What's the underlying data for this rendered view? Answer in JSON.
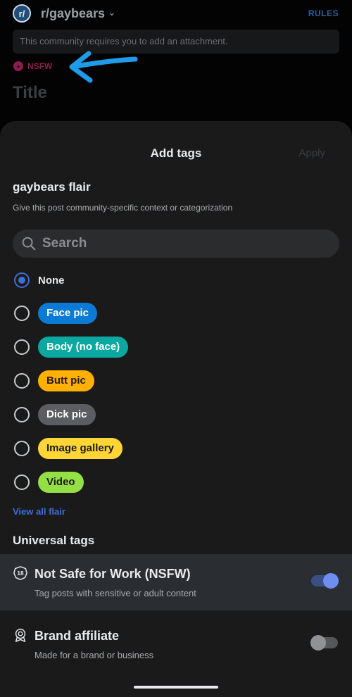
{
  "composer": {
    "subreddit": "r/gaybears",
    "avatar_letter": "r/",
    "rules_label": "RULES",
    "attachment_notice": "This community requires you to add an attachment.",
    "nsfw_label": "NSFW",
    "title_placeholder": "Title",
    "annotation_color": "#1e9be9"
  },
  "sheet": {
    "title": "Add tags",
    "apply_label": "Apply",
    "flair_heading": "gaybears flair",
    "flair_subtitle": "Give this post community-specific context or categorization",
    "search_placeholder": "Search",
    "options": [
      {
        "label": "None",
        "selected": true
      },
      {
        "label": "Face pic",
        "selected": false,
        "bg": "#0a7ad4",
        "fg": "#ffffff"
      },
      {
        "label": "Body (no face)",
        "selected": false,
        "bg": "#0aa8a0",
        "fg": "#ffffff"
      },
      {
        "label": "Butt pic",
        "selected": false,
        "bg": "#ffb000",
        "fg": "#1a1a1b"
      },
      {
        "label": "Dick pic",
        "selected": false,
        "bg": "#5a5e62",
        "fg": "#ffffff"
      },
      {
        "label": "Image gallery",
        "selected": false,
        "bg": "#ffd635",
        "fg": "#1a1a1b"
      },
      {
        "label": "Video",
        "selected": false,
        "bg": "#94e044",
        "fg": "#1a1a1b"
      }
    ],
    "view_all_label": "View all flair",
    "universal_heading": "Universal tags",
    "universal_tags": [
      {
        "title": "Not Safe for Work (NSFW)",
        "description": "Tag posts with sensitive or adult content",
        "enabled": true,
        "icon": "nsfw-18-icon"
      },
      {
        "title": "Brand affiliate",
        "description": "Made for a brand or business",
        "enabled": false,
        "icon": "brand-affiliate-icon"
      }
    ]
  },
  "colors": {
    "accent": "#3d6fd6",
    "nsfw": "#8b1d4f"
  }
}
